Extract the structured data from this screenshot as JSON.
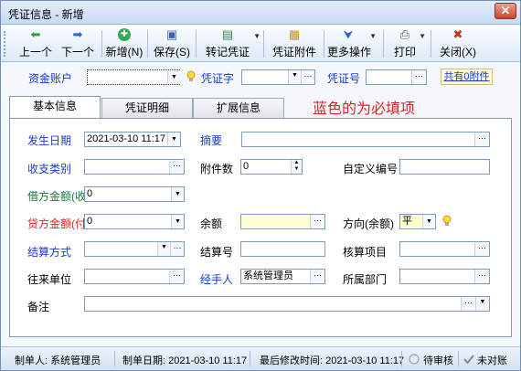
{
  "window": {
    "title": "凭证信息 - 新增",
    "close_glyph": "✕"
  },
  "toolbar": {
    "buttons": [
      {
        "id": "prev",
        "label": "上一个",
        "icon": "arrow-left-icon",
        "glyph": "⬅"
      },
      {
        "id": "next",
        "label": "下一个",
        "icon": "arrow-right-icon",
        "glyph": "➡"
      },
      {
        "id": "new",
        "label": "新增(N)",
        "icon": "add-icon",
        "glyph": "✚"
      },
      {
        "id": "save",
        "label": "保存(S)",
        "icon": "save-icon",
        "glyph": "▣"
      },
      {
        "id": "post",
        "label": "转记凭证",
        "icon": "post-voucher-icon",
        "glyph": "▤"
      },
      {
        "id": "attach",
        "label": "凭证附件",
        "icon": "attachment-icon",
        "glyph": "▦"
      },
      {
        "id": "more",
        "label": "更多操作",
        "icon": "more-icon",
        "glyph": "⮟"
      },
      {
        "id": "print",
        "label": "打印",
        "icon": "printer-icon",
        "glyph": "⎙"
      },
      {
        "id": "close",
        "label": "关闭(X)",
        "icon": "close-icon",
        "glyph": "✖"
      }
    ]
  },
  "header": {
    "account_label": "资金账户",
    "account_value": "",
    "voucher_word_label": "凭证字",
    "voucher_word_value": "",
    "voucher_no_label": "凭证号",
    "voucher_no_value": "",
    "attachment_link": "共有0附件"
  },
  "tabs": [
    "基本信息",
    "凭证明细",
    "扩展信息"
  ],
  "required_hint": "蓝色的为必填项",
  "form": {
    "date_label": "发生日期",
    "date_value": "2021-03-10 11:17",
    "summary_label": "摘要",
    "summary_value": "",
    "category_label": "收支类别",
    "category_value": "",
    "attachments_label": "附件数",
    "attachments_value": "0",
    "custom_no_label": "自定义编号",
    "custom_no_value": "",
    "debit_label": "借方金额(收)",
    "debit_value": "0",
    "credit_label": "贷方金额(付)",
    "credit_value": "0",
    "balance_label": "余额",
    "balance_value": "",
    "direction_label": "方向(余额)",
    "direction_value": "平",
    "settle_method_label": "结算方式",
    "settle_method_value": "",
    "settle_no_label": "结算号",
    "settle_no_value": "",
    "audit_item_label": "核算项目",
    "audit_item_value": "",
    "partner_label": "往来单位",
    "partner_value": "",
    "handler_label": "经手人",
    "handler_value": "系统管理员",
    "department_label": "所属部门",
    "department_value": "",
    "remark_label": "备注",
    "remark_value": ""
  },
  "statusbar": {
    "creator": "制单人: 系统管理员",
    "created_date": "制单日期: 2021-03-10 11:17",
    "modified": "最后修改时间: 2021-03-10 11:17",
    "review_status": "待审核",
    "reconcile_status": "未对账"
  },
  "colors": {
    "required": "#1a39d8",
    "debit": "#1a7a3a",
    "credit": "#e02020",
    "hint": "#e02020"
  }
}
